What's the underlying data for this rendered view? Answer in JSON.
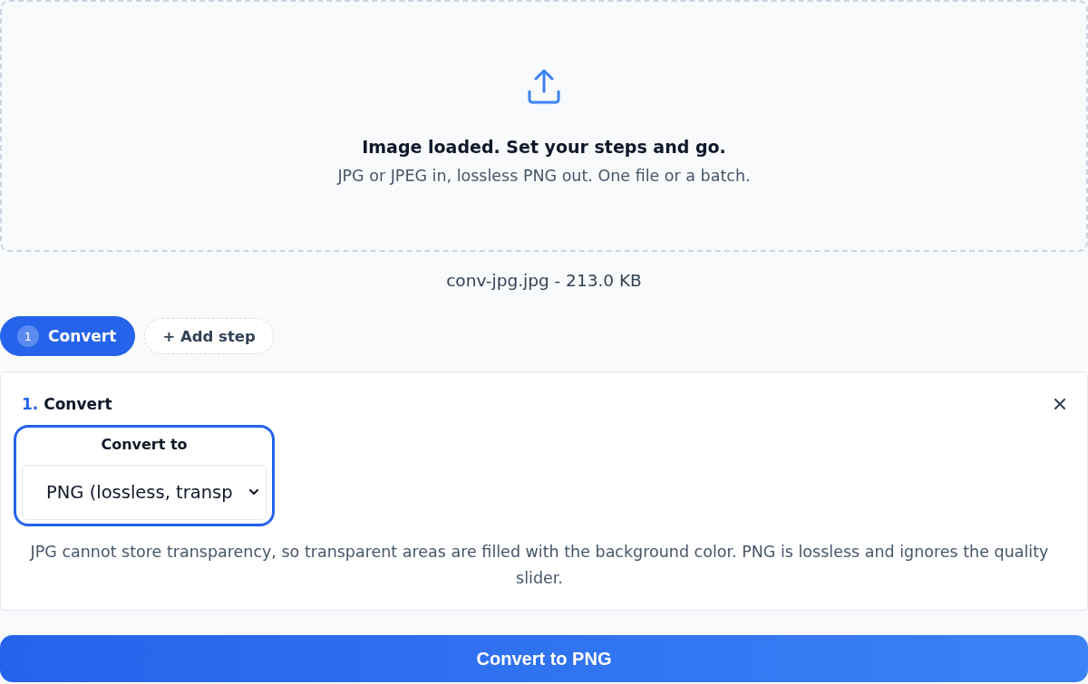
{
  "dropzone": {
    "title": "Image loaded. Set your steps and go.",
    "subtitle": "JPG or JPEG in, lossless PNG out. One file or a batch."
  },
  "file": {
    "label": "conv-jpg.jpg - 213.0 KB"
  },
  "steps": [
    {
      "number": "1",
      "label": "Convert",
      "selected": true
    }
  ],
  "add_step": {
    "label": "+ Add step"
  },
  "step_panel": {
    "number": "1.",
    "title": "Convert",
    "field": {
      "label": "Convert to",
      "value": "PNG (lossless, transp",
      "focused": true
    },
    "note": "JPG cannot store transparency, so transparent areas are filled with the background color. PNG is lossless and ignores the quality slider."
  },
  "primary_button": {
    "label": "Convert to PNG"
  }
}
